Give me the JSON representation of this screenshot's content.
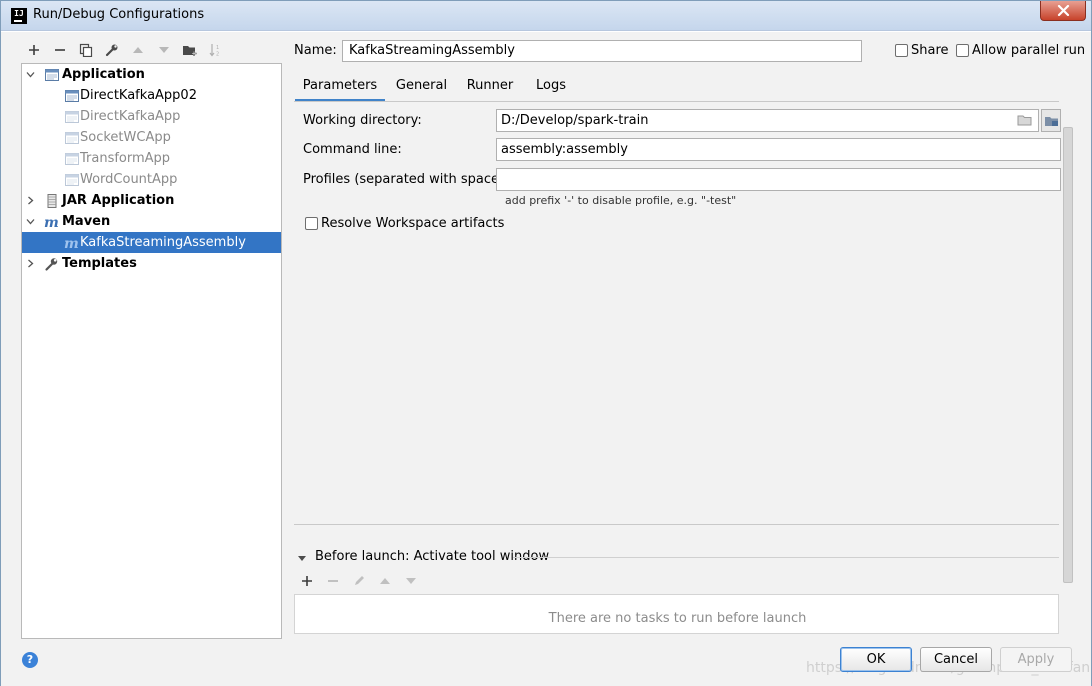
{
  "window": {
    "title": "Run/Debug Configurations"
  },
  "tree": {
    "items": [
      {
        "label": "Application"
      },
      {
        "label": "DirectKafkaApp02"
      },
      {
        "label": "DirectKafkaApp"
      },
      {
        "label": "SocketWCApp"
      },
      {
        "label": "TransformApp"
      },
      {
        "label": "WordCountApp"
      },
      {
        "label": "JAR Application"
      },
      {
        "label": "Maven"
      },
      {
        "label": "KafkaStreamingAssembly"
      },
      {
        "label": "Templates"
      }
    ]
  },
  "header": {
    "name_label": "Name:",
    "name_value": "KafkaStreamingAssembly",
    "share_label": "Share",
    "allow_parallel_label": "Allow parallel run"
  },
  "tabs": [
    {
      "label": "Parameters"
    },
    {
      "label": "General"
    },
    {
      "label": "Runner"
    },
    {
      "label": "Logs"
    }
  ],
  "parameters": {
    "working_directory_label": "Working directory:",
    "working_directory_value": "D:/Develop/spark-train",
    "command_line_label": "Command line:",
    "command_line_value": "assembly:assembly",
    "profiles_label": "Profiles (separated with space):",
    "profiles_value": "",
    "profiles_hint": "add prefix '-' to disable profile, e.g. \"-test\"",
    "resolve_label": "Resolve Workspace artifacts"
  },
  "before_launch": {
    "label": "Before launch: Activate tool window",
    "empty_text": "There are no tasks to run before launch"
  },
  "buttons": {
    "ok": "OK",
    "cancel": "Cancel",
    "apply": "Apply",
    "help": "?"
  },
  "watermark": "https://blog.csdn.net/greenplum_xiaofan",
  "colors": {
    "selection": "#3375c5",
    "tab_accent": "#4083c9",
    "help": "#3b82d8"
  }
}
